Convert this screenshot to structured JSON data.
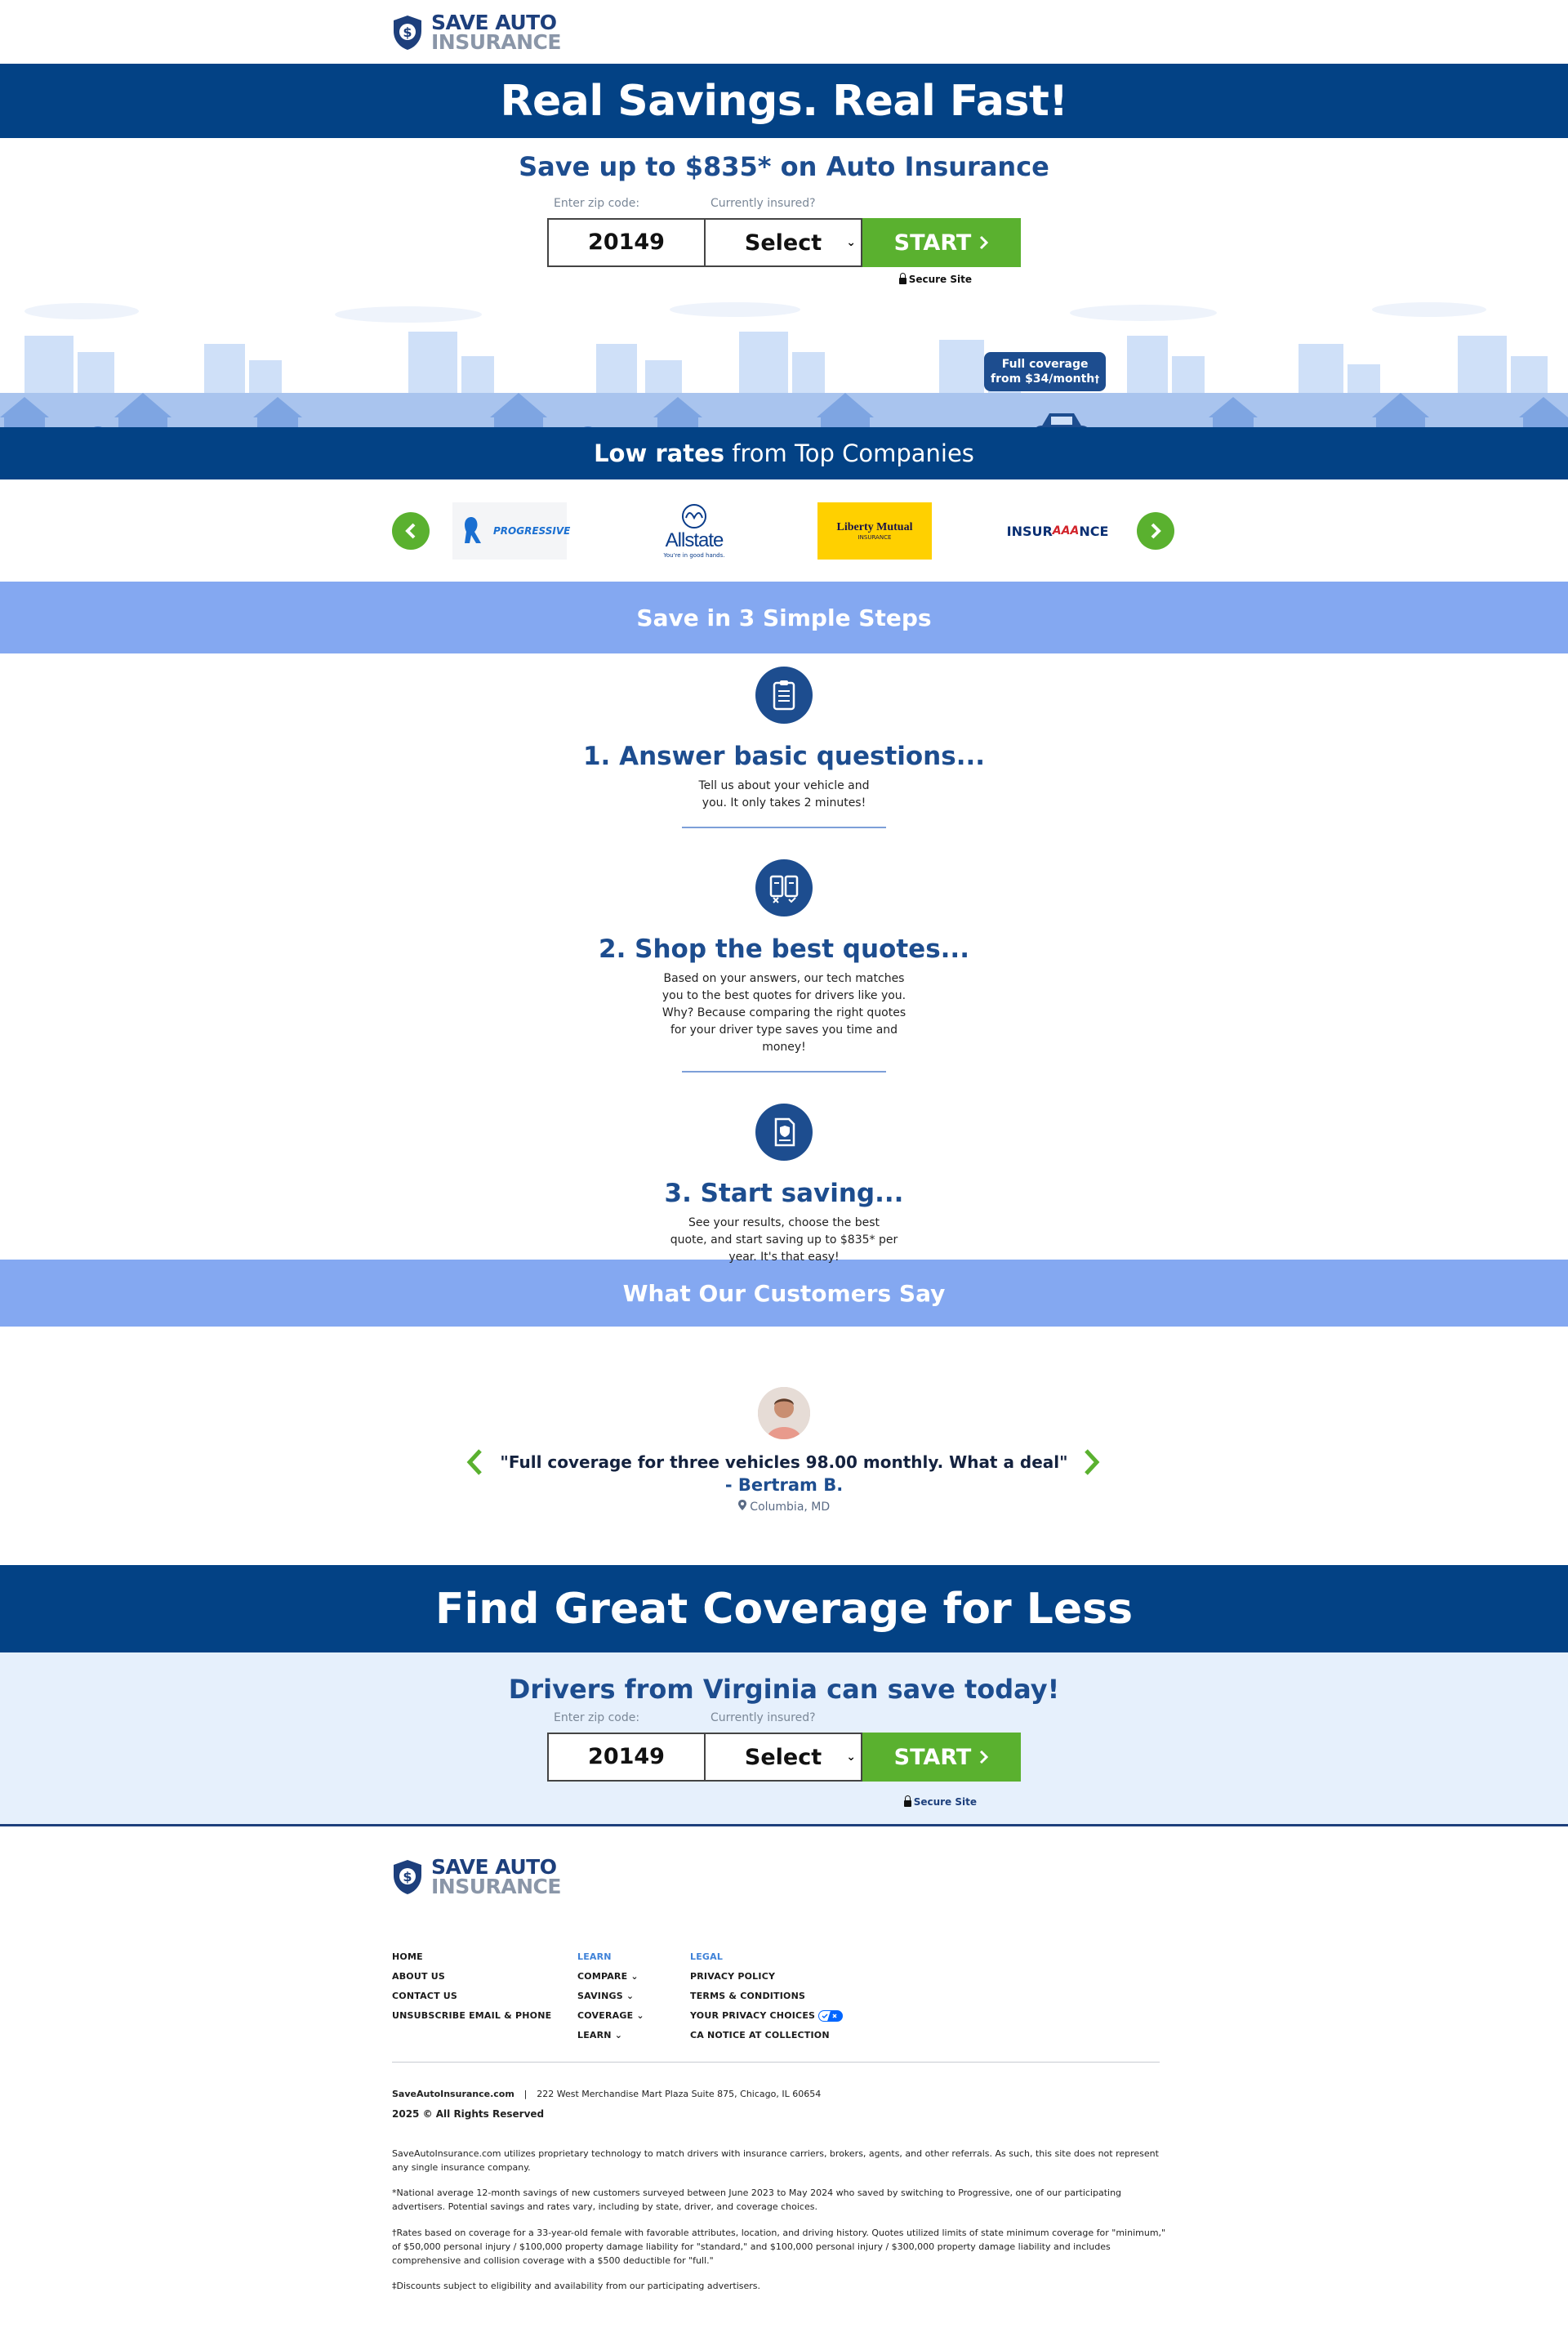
{
  "brand": {
    "line1": "SAVE AUTO",
    "line2": "INSURANCE"
  },
  "hero": {
    "title": "Real Savings. Real Fast!",
    "subtitle": "Save up to $835* on Auto Insurance"
  },
  "form": {
    "zip_label": "Enter zip code:",
    "insured_label": "Currently insured?",
    "zip_value": "20149",
    "select_value": "Select",
    "start_label": "START",
    "secure_label": "Secure Site"
  },
  "bubble": {
    "line1": "Full coverage",
    "line2": "from $34/month",
    "sup": "†"
  },
  "rates": {
    "bold": "Low rates",
    "rest": " from Top Companies"
  },
  "carriers": [
    "PROGRESSIVE",
    "Allstate",
    "Liberty Mutual",
    "INSURANCE"
  ],
  "carrier_misc": {
    "allstate_tag": "You're in good hands.",
    "liberty_sub": "INSURANCE",
    "aaa_pre": "INSUR",
    "aaa_mid": "AAA",
    "aaa_post": "NCE"
  },
  "steps_title": "Save in 3 Simple Steps",
  "steps": [
    {
      "title": "1. Answer basic questions...",
      "text": "Tell us about your vehicle and you. It only takes 2 minutes!"
    },
    {
      "title": "2. Shop the best quotes...",
      "text": "Based on your answers, our tech matches you to the best quotes for drivers like you. Why? Because comparing the right quotes for your driver type saves you time and money!"
    },
    {
      "title": "3. Start saving...",
      "text": "See your results, choose the best quote, and start saving up to $835* per year. It's that easy!"
    }
  ],
  "testimonials_title": "What Our Customers Say",
  "testimonial": {
    "quote": "\"Full coverage for three vehicles 98.00 monthly. What a deal\"",
    "author": "- Bertram B.",
    "location": "Columbia, MD"
  },
  "cta": {
    "title": "Find Great Coverage for Less",
    "subtitle": "Drivers from Virginia can save today!"
  },
  "footer": {
    "col1": [
      "HOME",
      "ABOUT US",
      "CONTACT US",
      "UNSUBSCRIBE EMAIL & PHONE"
    ],
    "col2_head": "LEARN",
    "col2": [
      "COMPARE",
      "SAVINGS",
      "COVERAGE",
      "LEARN"
    ],
    "col3_head": "LEGAL",
    "col3": [
      "PRIVACY POLICY",
      "TERMS & CONDITIONS",
      "YOUR PRIVACY CHOICES",
      "CA NOTICE AT COLLECTION"
    ],
    "site": "SaveAutoInsurance.com",
    "address": "222 West Merchandise Mart Plaza Suite 875, Chicago, IL 60654",
    "copyright": "2025 © All Rights Reserved",
    "disclaimer1": "SaveAutoInsurance.com utilizes proprietary technology to match drivers with insurance carriers, brokers, agents, and other referrals. As such, this site does not represent any single insurance company.",
    "disclaimer2": "*National average 12-month savings of new customers surveyed between June 2023 to May 2024 who saved by switching to Progressive, one of our participating advertisers. Potential savings and rates vary, including by state, driver, and coverage choices.",
    "disclaimer3": "†Rates based on coverage for a 33-year-old female with favorable attributes, location, and driving history. Quotes utilized limits of state minimum coverage for \"minimum,\" of $50,000 personal injury / $100,000 property damage liability for \"standard,\" and $100,000 personal injury / $300,000 property damage liability and includes comprehensive and collision coverage with a $500 deductible for \"full.\"",
    "disclaimer4": "‡Discounts subject to eligibility and availability from our participating advertisers."
  },
  "colors": {
    "navy": "#034285",
    "green": "#5ab12f",
    "light_blue": "#84a8f1",
    "cta_bg": "#e6f0fc"
  }
}
